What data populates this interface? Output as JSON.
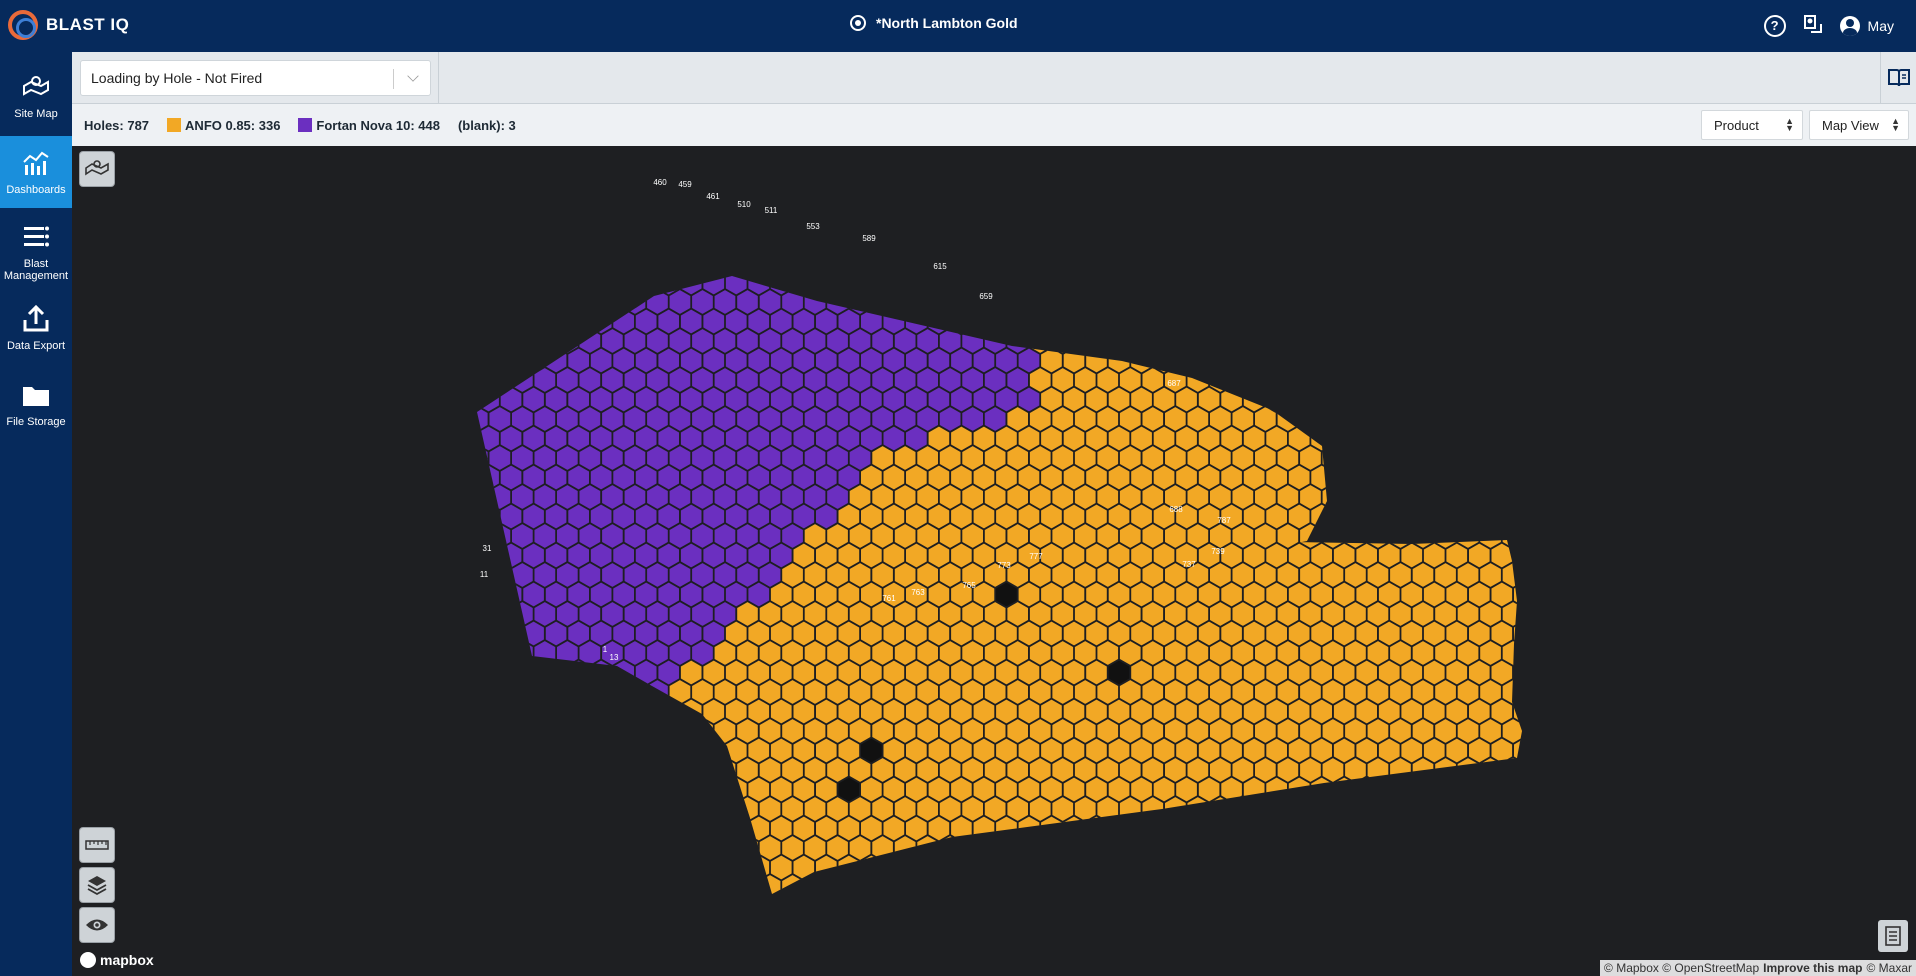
{
  "app": {
    "brand": "BLAST IQ",
    "project_title": "*North Lambton Gold",
    "user_name": "May"
  },
  "sidebar": {
    "items": [
      {
        "label": "Site Map",
        "icon": "map-pin-icon"
      },
      {
        "label": "Dashboards",
        "icon": "chart-icon",
        "active": true
      },
      {
        "label": "Blast Management",
        "icon": "list-icon"
      },
      {
        "label": "Data Export",
        "icon": "upload-icon"
      },
      {
        "label": "File Storage",
        "icon": "folder-icon"
      }
    ]
  },
  "toolbar": {
    "loading_select_value": "Loading by Hole - Not Fired"
  },
  "legend": {
    "holes_label": "Holes: 787",
    "items": [
      {
        "label": "ANFO 0.85: 336",
        "color": "#f2a825"
      },
      {
        "label": "Fortan Nova 10: 448",
        "color": "#6b2fc0"
      },
      {
        "label": "(blank): 3"
      }
    ],
    "product_select": "Product",
    "view_select": "Map View"
  },
  "map": {
    "colors": {
      "anfo": "#f2a825",
      "fortan": "#6b2fc0",
      "blank": "#111111",
      "background": "#1e1f22"
    },
    "counts": {
      "anfo": 336,
      "fortan": 448,
      "blank": 3
    },
    "visible_hole_labels": [
      "460",
      "459",
      "461",
      "510",
      "511",
      "553",
      "589",
      "615",
      "659",
      "687",
      "688",
      "787",
      "739",
      "737",
      "1",
      "11",
      "13",
      "31",
      "761",
      "763",
      "765",
      "773",
      "777"
    ],
    "attribution": {
      "text": "© Mapbox © OpenStreetMap",
      "improve": "Improve this map",
      "maxar": "© Maxar"
    },
    "logo": "mapbox"
  }
}
